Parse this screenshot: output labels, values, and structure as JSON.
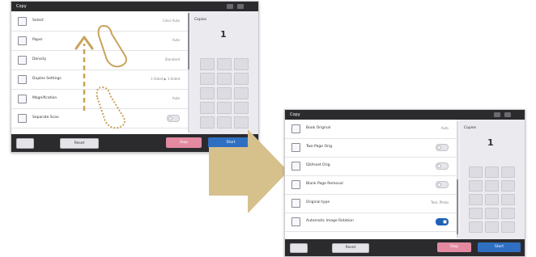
{
  "left_screen": {
    "title": "Copy",
    "rows": [
      {
        "label": "Select",
        "value": "Color Auto",
        "icon": "select-icon"
      },
      {
        "label": "Paper",
        "value": "Auto",
        "icon": "paper-icon"
      },
      {
        "label": "Density",
        "value": "Standard",
        "icon": "density-icon"
      },
      {
        "label": "Duplex Settings",
        "value": "1-Sided ▶ 1-Sided",
        "icon": "duplex-icon"
      },
      {
        "label": "Magnification",
        "value": "Auto",
        "icon": "magnification-icon"
      },
      {
        "label": "Separate Scan",
        "value": "",
        "icon": "separate-scan-icon",
        "toggle": "off"
      }
    ],
    "copies_label": "Copies",
    "copies_value": "1",
    "reset_label": "Reset",
    "start_label": "Stop",
    "go_label": "Start"
  },
  "right_screen": {
    "title": "Copy",
    "rows": [
      {
        "label": "Book Original",
        "value": "Auto",
        "icon": "book-icon"
      },
      {
        "label": "Two-Page Orig.",
        "value": "",
        "icon": "two-page-icon",
        "toggle": "off"
      },
      {
        "label": "ID/Asset Orig.",
        "value": "",
        "icon": "id-card-icon",
        "toggle": "off"
      },
      {
        "label": "Blank Page Removal",
        "value": "",
        "icon": "blank-page-icon",
        "toggle": "off"
      },
      {
        "label": "Original type",
        "value": "Text, Photo",
        "icon": "original-type-icon"
      },
      {
        "label": "Automatic Image Rotation",
        "value": "",
        "icon": "rotation-icon",
        "toggle": "on"
      }
    ],
    "copies_label": "Copies",
    "copies_value": "1",
    "reset_label": "Reset",
    "start_label": "Stop",
    "go_label": "Start"
  },
  "colors": {
    "gesture": "#c9a25b",
    "transition_arrow": "#d6c08c",
    "titlebar": "#2b2b2e",
    "start_button": "#2f6fc2",
    "stop_button": "#e38aa0",
    "toggle_on": "#1e62b8"
  }
}
